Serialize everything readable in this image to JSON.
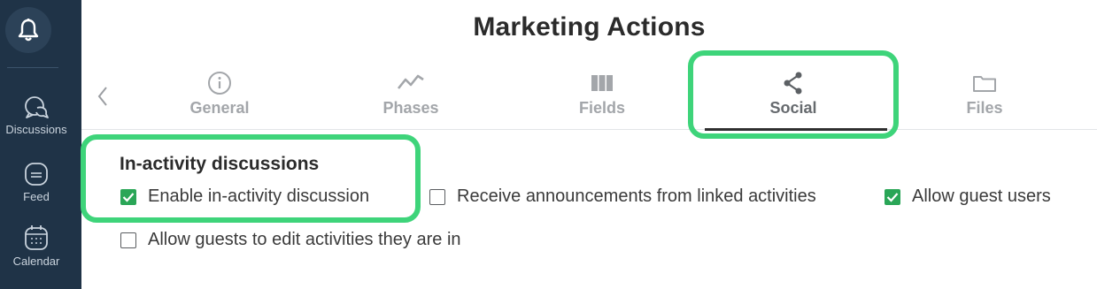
{
  "sidebar": {
    "bell_icon": "bell-icon",
    "items": [
      {
        "label": "Discussions",
        "icon": "chat-bubbles-icon"
      },
      {
        "label": "Feed",
        "icon": "feed-icon"
      },
      {
        "label": "Calendar",
        "icon": "calendar-icon"
      }
    ]
  },
  "header": {
    "title": "Marketing Actions"
  },
  "tabs": [
    {
      "label": "General",
      "icon": "info-icon"
    },
    {
      "label": "Phases",
      "icon": "phases-line-icon"
    },
    {
      "label": "Fields",
      "icon": "columns-icon"
    },
    {
      "label": "Social",
      "icon": "share-icon",
      "active": true
    },
    {
      "label": "Files",
      "icon": "folder-icon"
    }
  ],
  "section": {
    "title": "In-activity discussions",
    "options": [
      {
        "label": "Enable in-activity discussion",
        "checked": true
      },
      {
        "label": "Receive announcements from linked activities",
        "checked": false
      },
      {
        "label": "Allow guest users",
        "checked": true
      },
      {
        "label": "Allow guests to edit activities they are in",
        "checked": false
      }
    ]
  },
  "colors": {
    "sidebar": "#1f3347",
    "highlight": "#3ed47a",
    "checkbox_checked": "#2aa657"
  }
}
